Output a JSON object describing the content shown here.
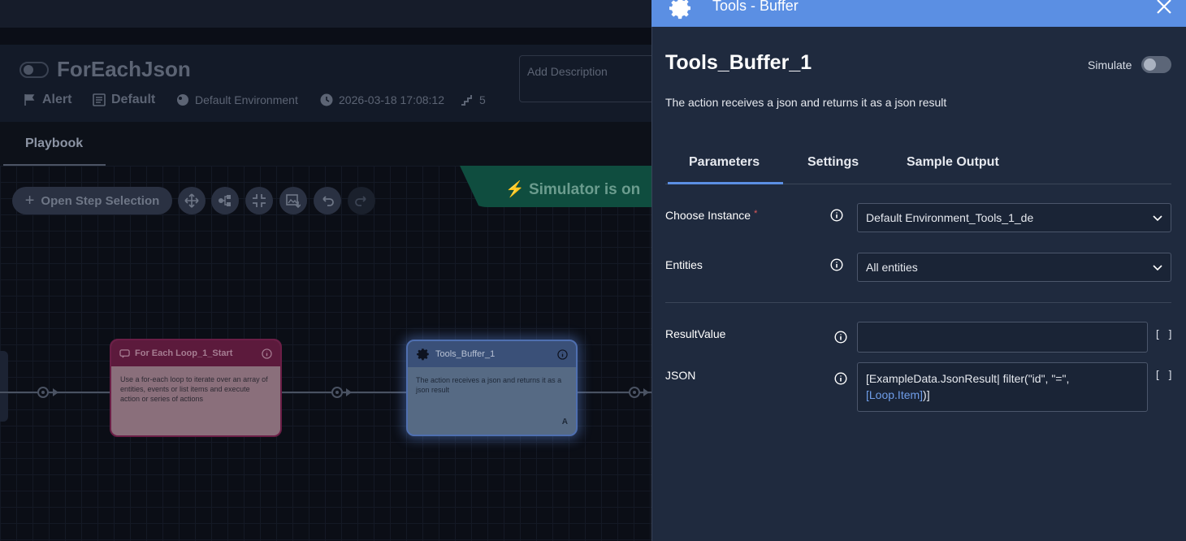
{
  "playbook": {
    "title": "ForEachJson",
    "meta": {
      "alert": "Alert",
      "priority": "Default",
      "environment": "Default Environment",
      "timestamp": "2026-03-18 17:08:12",
      "steps": "5"
    },
    "description_placeholder": "Add Description",
    "tab": "Playbook"
  },
  "toolbar": {
    "open_step_selection": "Open Step Selection"
  },
  "simulator_banner": "Simulator is on",
  "nodes": {
    "for_each": {
      "title": "For Each Loop_1_Start",
      "description": "Use a for-each loop to iterate over an array of entities, events or list items and execute action or series of actions"
    },
    "tools_buffer": {
      "title": "Tools_Buffer_1",
      "description": "The action receives a json and returns it as a json result",
      "badge": "A"
    }
  },
  "panel": {
    "header_title": "Tools - Buffer",
    "step_title": "Tools_Buffer_1",
    "simulate_label": "Simulate",
    "description": "The action receives a json and returns it as a json result",
    "tabs": [
      "Parameters",
      "Settings",
      "Sample Output"
    ],
    "fields": {
      "choose_instance": {
        "label": "Choose Instance",
        "required": "*",
        "value": "Default Environment_Tools_1_de"
      },
      "entities": {
        "label": "Entities",
        "value": "All entities"
      },
      "result_value": {
        "label": "ResultValue",
        "value": ""
      },
      "json": {
        "label": "JSON",
        "value_line1": "[ExampleData.JsonResult| filter(\"id\", \"=\",",
        "value_line2": "[Loop.Item]",
        "value_end": ")]"
      }
    },
    "brackets_symbol": "[ ]"
  },
  "colors": {
    "accent": "#5b8fe3",
    "panel_bg": "#1f2a3e",
    "simulator_green": "#0f4d3f",
    "loop_node": "#6b1e46"
  }
}
